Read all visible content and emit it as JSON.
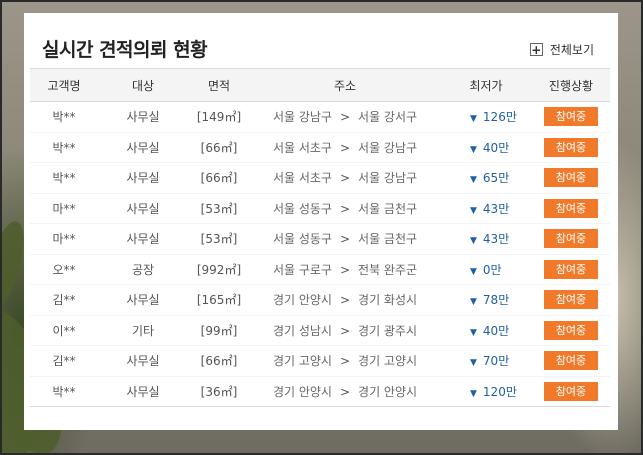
{
  "panel": {
    "title": "실시간 견적의뢰 현황",
    "view_all_label": "전체보기",
    "view_all_icon": "plus-icon"
  },
  "table": {
    "headers": [
      "고객명",
      "대상",
      "면적",
      "주소",
      "최저가",
      "진행상황"
    ],
    "rows": [
      {
        "customer": "박**",
        "target": "사무실",
        "area": "[149㎡]",
        "from": "서울 강남구",
        "to": "서울 강서구",
        "price": "126만",
        "status": "참여중"
      },
      {
        "customer": "박**",
        "target": "사무실",
        "area": "[66㎡]",
        "from": "서울 서초구",
        "to": "서울 강남구",
        "price": "40만",
        "status": "참여중"
      },
      {
        "customer": "박**",
        "target": "사무실",
        "area": "[66㎡]",
        "from": "서울 서초구",
        "to": "서울 강남구",
        "price": "65만",
        "status": "참여중"
      },
      {
        "customer": "마**",
        "target": "사무실",
        "area": "[53㎡]",
        "from": "서울 성동구",
        "to": "서울 금천구",
        "price": "43만",
        "status": "참여중"
      },
      {
        "customer": "마**",
        "target": "사무실",
        "area": "[53㎡]",
        "from": "서울 성동구",
        "to": "서울 금천구",
        "price": "43만",
        "status": "참여중"
      },
      {
        "customer": "오**",
        "target": "공장",
        "area": "[992㎡]",
        "from": "서울 구로구",
        "to": "전북 완주군",
        "price": "0만",
        "status": "참여중"
      },
      {
        "customer": "김**",
        "target": "사무실",
        "area": "[165㎡]",
        "from": "경기 안양시",
        "to": "경기 화성시",
        "price": "78만",
        "status": "참여중"
      },
      {
        "customer": "이**",
        "target": "기타",
        "area": "[99㎡]",
        "from": "경기 성남시",
        "to": "경기 광주시",
        "price": "40만",
        "status": "참여중"
      },
      {
        "customer": "김**",
        "target": "사무실",
        "area": "[66㎡]",
        "from": "경기 고양시",
        "to": "경기 고양시",
        "price": "70만",
        "status": "참여중"
      },
      {
        "customer": "박**",
        "target": "사무실",
        "area": "[36㎡]",
        "from": "경기 안양시",
        "to": "경기 안양시",
        "price": "120만",
        "status": "참여중"
      }
    ],
    "arrow_glyph": ">",
    "price_icon": "down-triangle-icon"
  },
  "colors": {
    "badge": "#f07a2a",
    "price": "#1f5fa8"
  }
}
